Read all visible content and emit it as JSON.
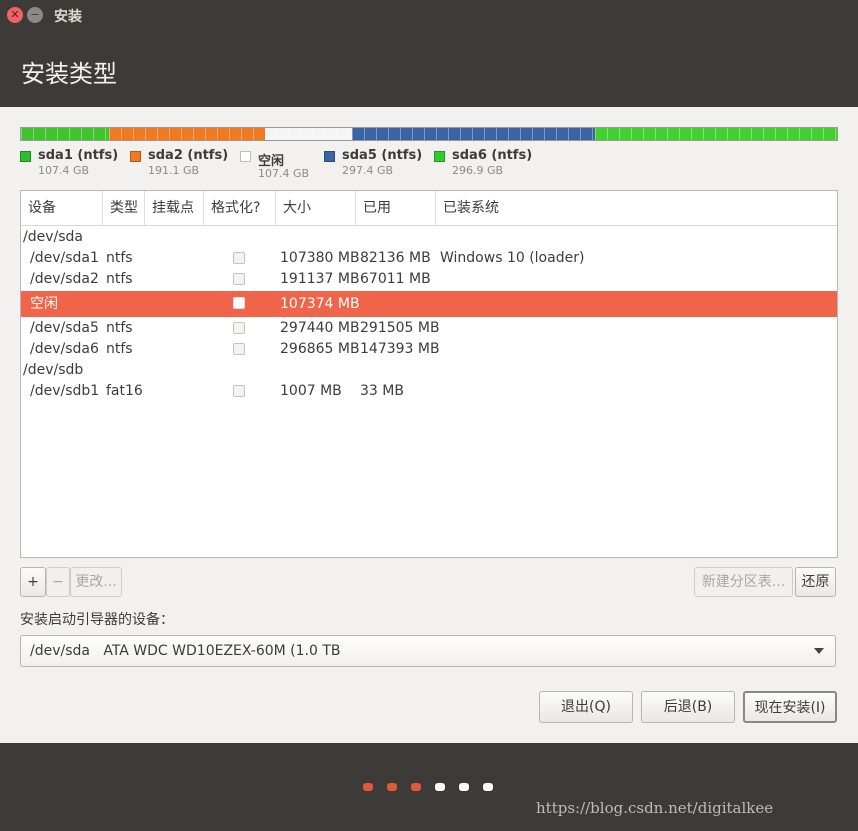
{
  "window": {
    "title": "安装"
  },
  "header": {
    "title": "安装类型"
  },
  "disk_segments": [
    {
      "color": "#3fc42c",
      "size_gb": 107.4
    },
    {
      "color": "#f07a22",
      "size_gb": 191.1
    },
    {
      "color": "#f5f5f5",
      "size_gb": 107.4
    },
    {
      "color": "#3c64a4",
      "size_gb": 297.4
    },
    {
      "color": "#41d12e",
      "size_gb": 296.9
    }
  ],
  "legend": [
    {
      "name": "sda1 (ntfs)",
      "size": "107.4 GB",
      "color": "#2ebd2e"
    },
    {
      "name": "sda2 (ntfs)",
      "size": "191.1 GB",
      "color": "#f07a22"
    },
    {
      "name": "空闲",
      "size": "107.4 GB",
      "color": "#ffffff"
    },
    {
      "name": "sda5 (ntfs)",
      "size": "297.4 GB",
      "color": "#3c64a4"
    },
    {
      "name": "sda6 (ntfs)",
      "size": "296.9 GB",
      "color": "#2ecc2e"
    }
  ],
  "table": {
    "headers": [
      "设备",
      "类型",
      "挂载点",
      "格式化?",
      "大小",
      "已用",
      "已装系统"
    ],
    "rows": [
      {
        "device": "/dev/sda",
        "group": true
      },
      {
        "device": "/dev/sda1",
        "type": "ntfs",
        "mount": "",
        "format": false,
        "size": "107380 MB",
        "used": "82136 MB",
        "system": "Windows 10 (loader)"
      },
      {
        "device": "/dev/sda2",
        "type": "ntfs",
        "mount": "",
        "format": false,
        "size": "191137 MB",
        "used": "67011 MB",
        "system": ""
      },
      {
        "device": "空闲",
        "type": "",
        "mount": "",
        "format": false,
        "size": "107374 MB",
        "used": "",
        "system": "",
        "selected": true
      },
      {
        "device": "/dev/sda5",
        "type": "ntfs",
        "mount": "",
        "format": false,
        "size": "297440 MB",
        "used": "291505 MB",
        "system": ""
      },
      {
        "device": "/dev/sda6",
        "type": "ntfs",
        "mount": "",
        "format": false,
        "size": "296865 MB",
        "used": "147393 MB",
        "system": ""
      },
      {
        "device": "/dev/sdb",
        "group": true
      },
      {
        "device": "/dev/sdb1",
        "type": "fat16",
        "mount": "",
        "format": false,
        "size": "1007 MB",
        "used": "33 MB",
        "system": ""
      }
    ]
  },
  "toolbar": {
    "add_label": "+",
    "remove_label": "−",
    "change_label": "更改...",
    "new_table_label": "新建分区表...",
    "revert_label": "还原"
  },
  "boot": {
    "label": "安装启动引导器的设备：",
    "selected": "/dev/sda   ATA WDC WD10EZEX-60M (1.0 TB"
  },
  "actions": {
    "quit_label": "退出(Q)",
    "back_label": "后退(B)",
    "install_label": "现在安装(I)"
  },
  "progress": {
    "dots": [
      "#e05a3a",
      "#e05a3a",
      "#e05a3a",
      "#ffffff",
      "#ffffff",
      "#ffffff"
    ]
  },
  "watermark": "https://blog.csdn.net/digitalkee"
}
